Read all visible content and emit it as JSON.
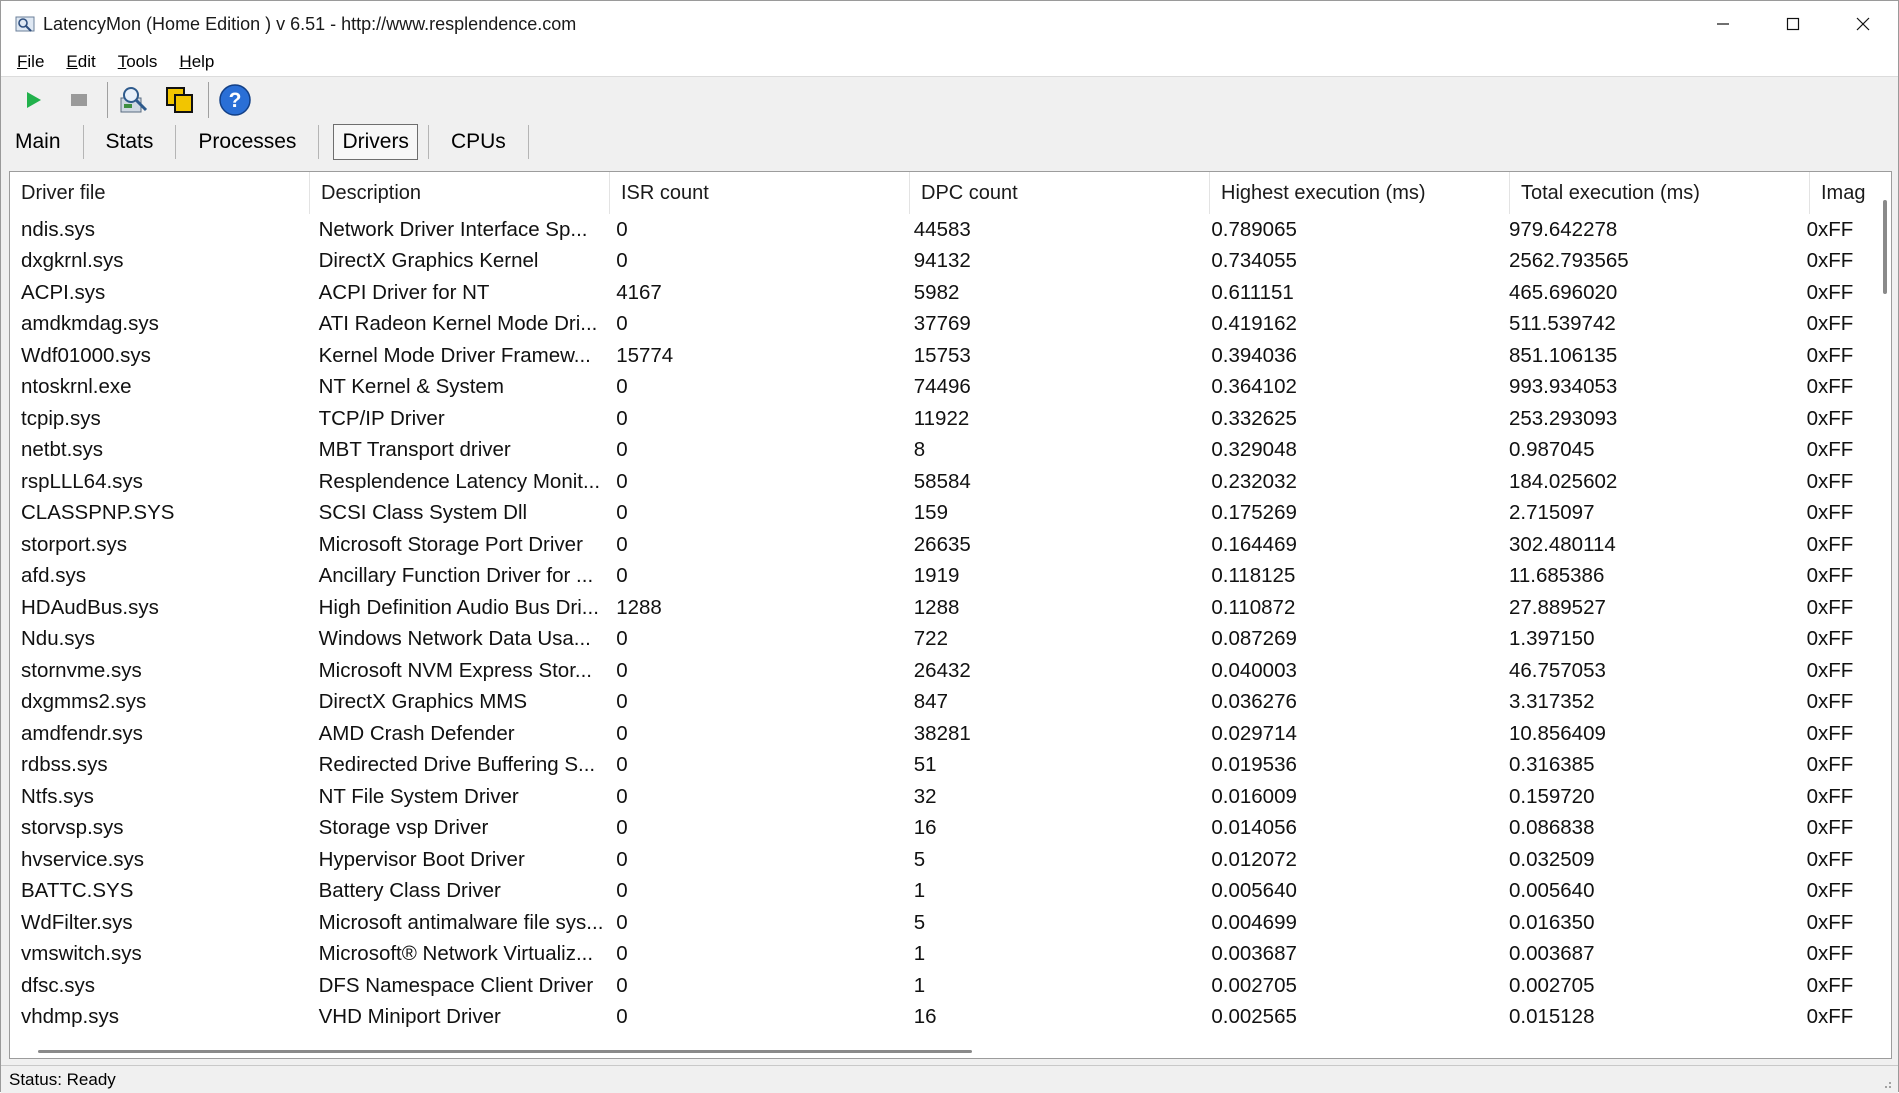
{
  "window": {
    "title": "LatencyMon  (Home Edition )  v 6.51 - http://www.resplendence.com"
  },
  "menu": [
    {
      "label": "File",
      "accel": "F",
      "rest": "ile"
    },
    {
      "label": "Edit",
      "accel": "E",
      "rest": "dit"
    },
    {
      "label": "Tools",
      "accel": "T",
      "rest": "ools"
    },
    {
      "label": "Help",
      "accel": "H",
      "rest": "elp"
    }
  ],
  "toolbar": {
    "icons": [
      "play-icon",
      "stop-icon",
      "drivers-icon",
      "windows-icon",
      "help-icon"
    ]
  },
  "tabs": [
    "Main",
    "Stats",
    "Processes",
    "Drivers",
    "CPUs"
  ],
  "active_tab": "Drivers",
  "table": {
    "columns": [
      "Driver file",
      "Description",
      "ISR count",
      "DPC count",
      "Highest execution (ms)",
      "Total execution (ms)",
      "Imag"
    ],
    "rows": [
      [
        "ndis.sys",
        "Network Driver Interface Sp...",
        "0",
        "44583",
        "0.789065",
        "979.642278",
        "0xFF"
      ],
      [
        "dxgkrnl.sys",
        "DirectX Graphics Kernel",
        "0",
        "94132",
        "0.734055",
        "2562.793565",
        "0xFF"
      ],
      [
        "ACPI.sys",
        "ACPI Driver for NT",
        "4167",
        "5982",
        "0.611151",
        "465.696020",
        "0xFF"
      ],
      [
        "amdkmdag.sys",
        "ATI Radeon Kernel Mode Dri...",
        "0",
        "37769",
        "0.419162",
        "511.539742",
        "0xFF"
      ],
      [
        "Wdf01000.sys",
        "Kernel Mode Driver Framew...",
        "15774",
        "15753",
        "0.394036",
        "851.106135",
        "0xFF"
      ],
      [
        "ntoskrnl.exe",
        "NT Kernel & System",
        "0",
        "74496",
        "0.364102",
        "993.934053",
        "0xFF"
      ],
      [
        "tcpip.sys",
        "TCP/IP Driver",
        "0",
        "11922",
        "0.332625",
        "253.293093",
        "0xFF"
      ],
      [
        "netbt.sys",
        "MBT Transport driver",
        "0",
        "8",
        "0.329048",
        "0.987045",
        "0xFF"
      ],
      [
        "rspLLL64.sys",
        "Resplendence Latency Monit...",
        "0",
        "58584",
        "0.232032",
        "184.025602",
        "0xFF"
      ],
      [
        "CLASSPNP.SYS",
        "SCSI Class System Dll",
        "0",
        "159",
        "0.175269",
        "2.715097",
        "0xFF"
      ],
      [
        "storport.sys",
        "Microsoft Storage Port Driver",
        "0",
        "26635",
        "0.164469",
        "302.480114",
        "0xFF"
      ],
      [
        "afd.sys",
        "Ancillary Function Driver for ...",
        "0",
        "1919",
        "0.118125",
        "11.685386",
        "0xFF"
      ],
      [
        "HDAudBus.sys",
        "High Definition Audio Bus Dri...",
        "1288",
        "1288",
        "0.110872",
        "27.889527",
        "0xFF"
      ],
      [
        "Ndu.sys",
        "Windows Network Data Usa...",
        "0",
        "722",
        "0.087269",
        "1.397150",
        "0xFF"
      ],
      [
        "stornvme.sys",
        "Microsoft NVM Express Stor...",
        "0",
        "26432",
        "0.040003",
        "46.757053",
        "0xFF"
      ],
      [
        "dxgmms2.sys",
        "DirectX Graphics MMS",
        "0",
        "847",
        "0.036276",
        "3.317352",
        "0xFF"
      ],
      [
        "amdfendr.sys",
        "AMD Crash Defender",
        "0",
        "38281",
        "0.029714",
        "10.856409",
        "0xFF"
      ],
      [
        "rdbss.sys",
        "Redirected Drive Buffering S...",
        "0",
        "51",
        "0.019536",
        "0.316385",
        "0xFF"
      ],
      [
        "Ntfs.sys",
        "NT File System Driver",
        "0",
        "32",
        "0.016009",
        "0.159720",
        "0xFF"
      ],
      [
        "storvsp.sys",
        "Storage vsp Driver",
        "0",
        "16",
        "0.014056",
        "0.086838",
        "0xFF"
      ],
      [
        "hvservice.sys",
        "Hypervisor Boot Driver",
        "0",
        "5",
        "0.012072",
        "0.032509",
        "0xFF"
      ],
      [
        "BATTC.SYS",
        "Battery Class Driver",
        "0",
        "1",
        "0.005640",
        "0.005640",
        "0xFF"
      ],
      [
        "WdFilter.sys",
        "Microsoft antimalware file sys...",
        "0",
        "5",
        "0.004699",
        "0.016350",
        "0xFF"
      ],
      [
        "vmswitch.sys",
        "Microsoft® Network Virtualiz...",
        "0",
        "1",
        "0.003687",
        "0.003687",
        "0xFF"
      ],
      [
        "dfsc.sys",
        "DFS Namespace Client Driver",
        "0",
        "1",
        "0.002705",
        "0.002705",
        "0xFF"
      ],
      [
        "vhdmp.sys",
        "VHD Miniport Driver",
        "0",
        "16",
        "0.002565",
        "0.015128",
        "0xFF"
      ]
    ]
  },
  "status": "Status: Ready",
  "colors": {
    "play": "#22b14c",
    "stop": "#9a9a9a",
    "help": "#2a6fd6"
  }
}
